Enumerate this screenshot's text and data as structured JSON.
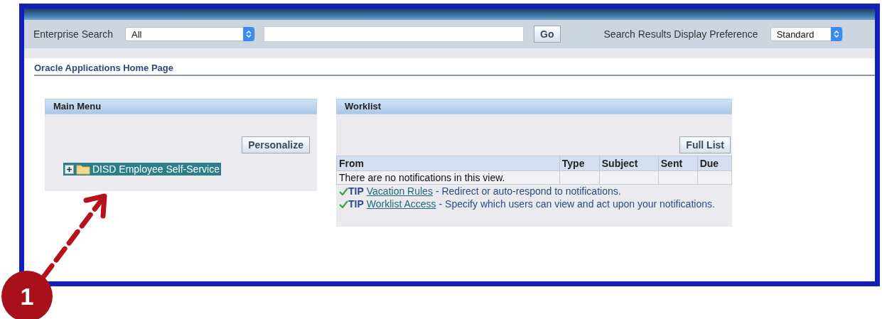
{
  "search_bar": {
    "label": "Enterprise Search",
    "scope": "All",
    "go_button": "Go",
    "preference_label": "Search Results Display Preference",
    "preference": "Standard"
  },
  "page_title": "Oracle Applications Home Page",
  "main_menu": {
    "title": "Main Menu",
    "personalize_button": "Personalize",
    "items": [
      {
        "label": "DISD Employee Self-Service",
        "selected": true,
        "expanded": false
      }
    ]
  },
  "worklist": {
    "title": "Worklist",
    "full_list_button": "Full List",
    "columns": [
      "From",
      "Type",
      "Subject",
      "Sent",
      "Due"
    ],
    "empty_message": "There are no notifications in this view.",
    "tips": [
      {
        "label": "TIP",
        "link": "Vacation Rules",
        "text": "- Redirect or auto-respond to notifications."
      },
      {
        "label": "TIP",
        "link": "Worklist Access",
        "text": "- Specify which users can view and act upon your notifications."
      }
    ]
  },
  "annotation": {
    "badge": "1"
  }
}
